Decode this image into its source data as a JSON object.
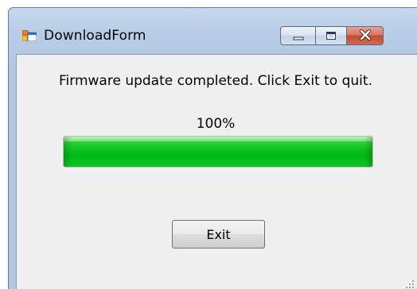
{
  "window": {
    "title": "DownloadForm",
    "icon": "windows-form-icon",
    "caption_buttons": [
      "minimize-icon",
      "maximize-icon",
      "close-icon"
    ]
  },
  "content": {
    "message": "Firmware update completed. Click Exit to quit.",
    "progress_text": "100%",
    "progress_value": 1.0,
    "progress_color": "#06c31a"
  },
  "actions": {
    "exit_label": "Exit"
  },
  "colors": {
    "close_button": "#c44a2f",
    "frame": "#b9cde6",
    "client_background": "#f0f0f0"
  }
}
